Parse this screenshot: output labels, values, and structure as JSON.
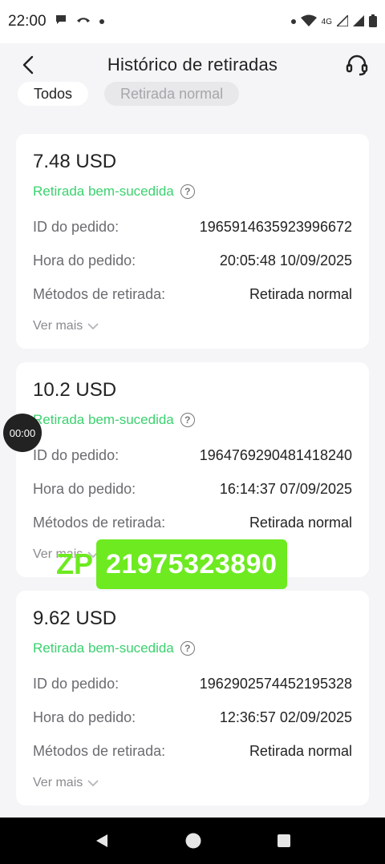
{
  "status_bar": {
    "time": "22:00",
    "network": "4G"
  },
  "header": {
    "title": "Histórico de retiradas"
  },
  "filters": [
    {
      "label": "Todos",
      "active": true
    },
    {
      "label": "Retirada normal",
      "active": false
    }
  ],
  "labels": {
    "order_id": "ID do pedido:",
    "order_time": "Hora do pedido:",
    "method": "Métodos de retirada:",
    "more": "Ver mais"
  },
  "records": [
    {
      "amount": "7.48 USD",
      "status": "Retirada bem-sucedida",
      "order_id": "1965914635923996672",
      "order_time": "20:05:48 10/09/2025",
      "method": "Retirada normal"
    },
    {
      "amount": "10.2 USD",
      "status": "Retirada bem-sucedida",
      "order_id": "1964769290481418240",
      "order_time": "16:14:37 07/09/2025",
      "method": "Retirada normal"
    },
    {
      "amount": "9.62 USD",
      "status": "Retirada bem-sucedida",
      "order_id": "1962902574452195328",
      "order_time": "12:36:57 02/09/2025",
      "method": "Retirada normal"
    }
  ],
  "timer_badge": "00:00",
  "overlay": {
    "prefix": "ZP",
    "number": "21975323890"
  },
  "colors": {
    "success": "#3bd16f",
    "overlay": "#6dea20",
    "background": "#f5f5f7"
  },
  "icons": [
    "back-arrow-icon",
    "headset-icon",
    "help-circle-icon",
    "chevron-down-icon"
  ]
}
